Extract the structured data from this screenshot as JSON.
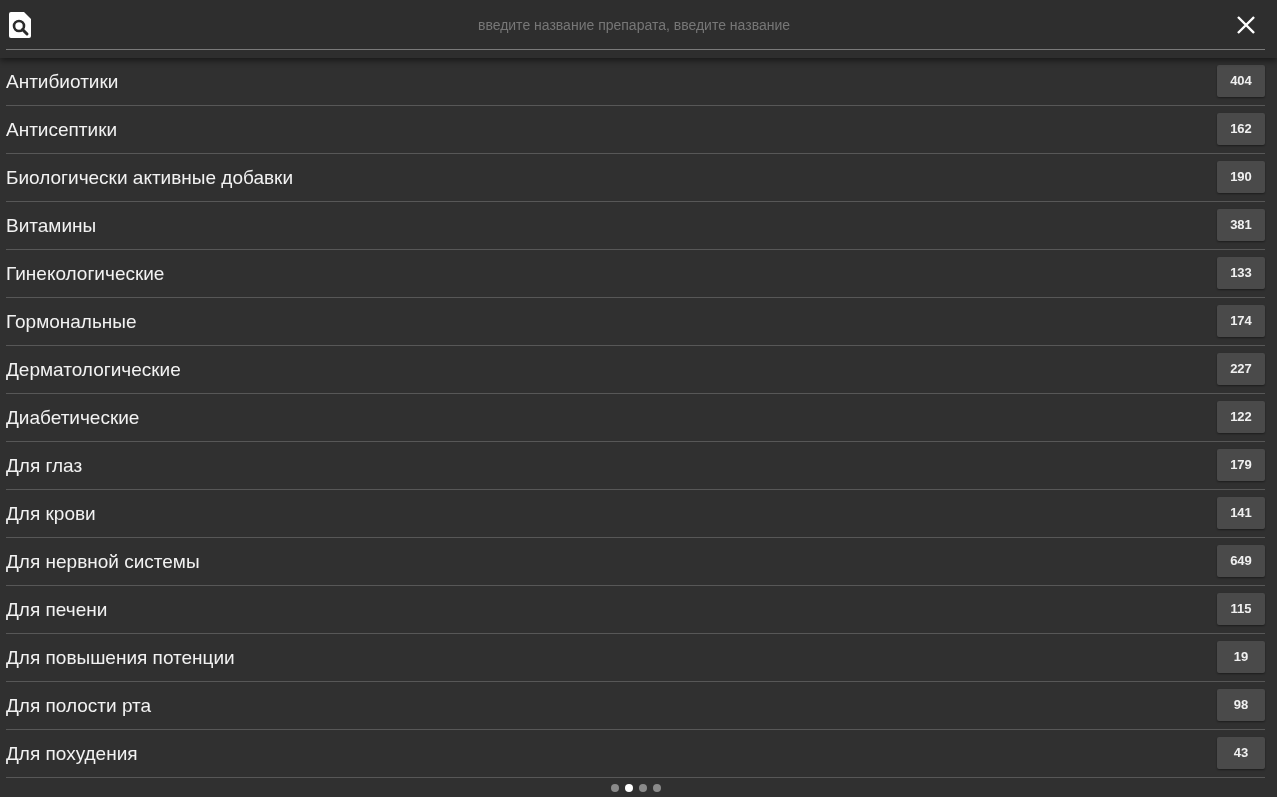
{
  "search": {
    "placeholder": "введите название препарата, введите название"
  },
  "categories": [
    {
      "name": "Антибиотики",
      "count": "404"
    },
    {
      "name": "Антисептики",
      "count": "162"
    },
    {
      "name": "Биологически активные добавки",
      "count": "190"
    },
    {
      "name": "Витамины",
      "count": "381"
    },
    {
      "name": "Гинекологические",
      "count": "133"
    },
    {
      "name": "Гормональные",
      "count": "174"
    },
    {
      "name": "Дерматологические",
      "count": "227"
    },
    {
      "name": "Диабетические",
      "count": "122"
    },
    {
      "name": "Для глаз",
      "count": "179"
    },
    {
      "name": "Для крови",
      "count": "141"
    },
    {
      "name": "Для нервной системы",
      "count": "649"
    },
    {
      "name": "Для печени",
      "count": "115"
    },
    {
      "name": "Для повышения потенции",
      "count": "19"
    },
    {
      "name": "Для полости рта",
      "count": "98"
    },
    {
      "name": "Для похудения",
      "count": "43"
    }
  ],
  "page_dots": [
    {
      "selected": false
    },
    {
      "selected": true
    },
    {
      "selected": false
    },
    {
      "selected": false
    }
  ]
}
